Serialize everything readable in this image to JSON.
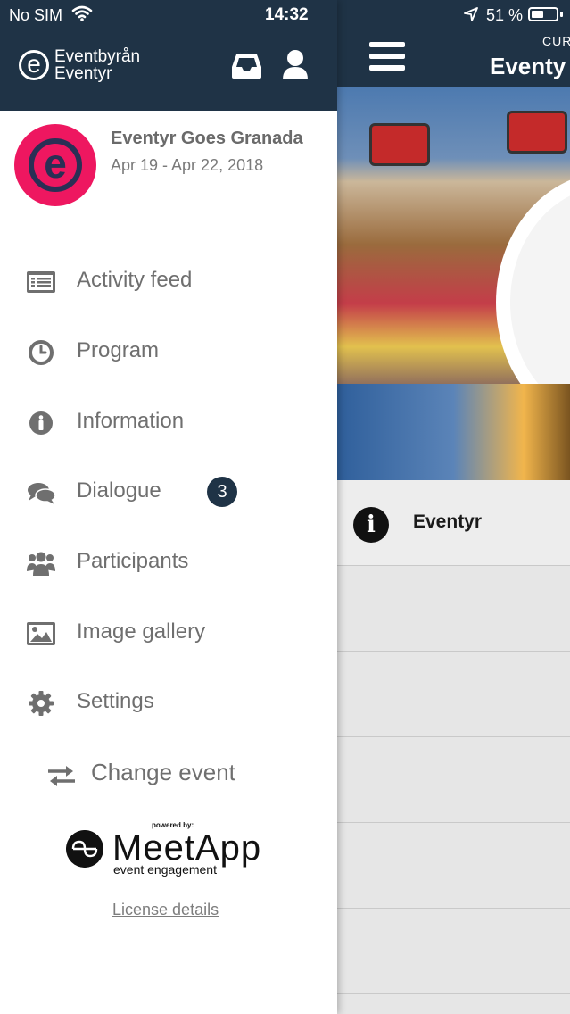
{
  "status_bar": {
    "carrier": "No SIM",
    "time": "14:32",
    "battery": "51 %",
    "battery_level": 0.51
  },
  "background": {
    "header_sup": "CUR",
    "header_title": "Eventy",
    "info_row_label": "Eventyr"
  },
  "drawer": {
    "logo_line1": "Eventbyrån",
    "logo_line2": "Eventyr",
    "event": {
      "name": "Eventyr Goes Granada",
      "dates": "Apr 19 - Apr 22, 2018"
    },
    "menu": [
      {
        "label": "Activity feed",
        "icon": "newspaper-icon"
      },
      {
        "label": "Program",
        "icon": "clock-icon"
      },
      {
        "label": "Information",
        "icon": "info-icon"
      },
      {
        "label": "Dialogue",
        "icon": "chat-icon",
        "badge": "3"
      },
      {
        "label": "Participants",
        "icon": "users-icon"
      },
      {
        "label": "Image gallery",
        "icon": "image-icon"
      },
      {
        "label": "Settings",
        "icon": "gear-icon"
      }
    ],
    "change_event": "Change event",
    "powered_by": "powered by:",
    "brand": "MeetApp",
    "brand_tagline": "event engagement",
    "license": "License details"
  },
  "colors": {
    "header_bg": "#1f3346",
    "event_avatar": "#ee1760",
    "menu_text": "#6f6f6f",
    "badge_bg": "#1f3346"
  }
}
